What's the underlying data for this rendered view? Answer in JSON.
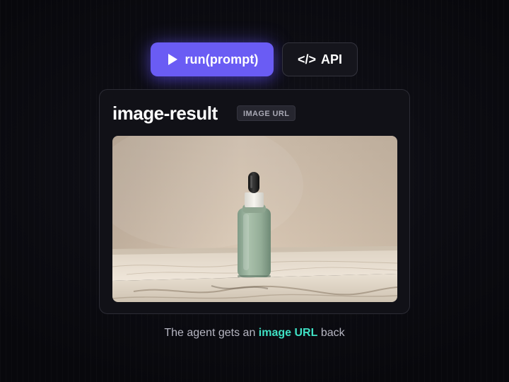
{
  "actions": {
    "run_label": "run(prompt)",
    "run_icon": "play-icon",
    "api_label": "API",
    "api_icon": "</>",
    "accent_color": "#6a5cf4"
  },
  "card": {
    "title": "image-result",
    "badge": "IMAGE URL",
    "image_icon": "dropper-bottle-photo"
  },
  "caption": {
    "before": "The agent gets an ",
    "highlight": "image URL",
    "after": " back",
    "highlight_color": "#3fe0c4"
  }
}
